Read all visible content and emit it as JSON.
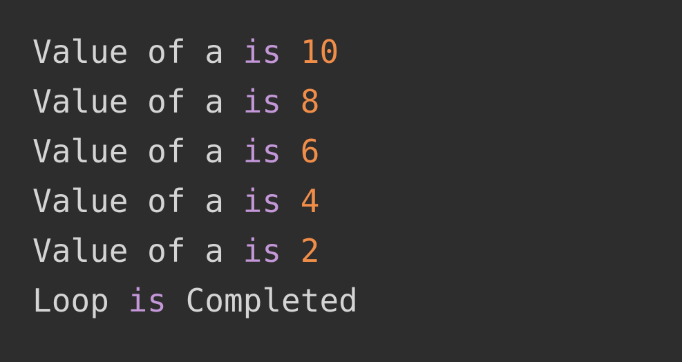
{
  "output": {
    "lines": [
      {
        "text": "Value of a",
        "keyword": "is",
        "number": "10"
      },
      {
        "text": "Value of a",
        "keyword": "is",
        "number": "8"
      },
      {
        "text": "Value of a",
        "keyword": "is",
        "number": "6"
      },
      {
        "text": "Value of a",
        "keyword": "is",
        "number": "4"
      },
      {
        "text": "Value of a",
        "keyword": "is",
        "number": "2"
      }
    ],
    "final": {
      "text": "Loop",
      "keyword": "is",
      "tail": "Completed"
    }
  },
  "colors": {
    "background": "#2d2d2d",
    "text": "#d4d4d4",
    "keyword": "#c397d8",
    "number": "#f08d49"
  }
}
